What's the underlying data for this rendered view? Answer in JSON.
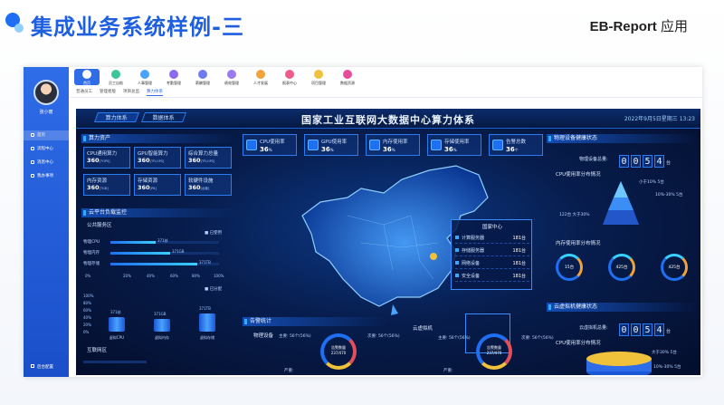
{
  "slide": {
    "title": "集成业务系统样例-三",
    "brand_main": "EB-Report",
    "brand_sub": "应用"
  },
  "sidebar": {
    "user_name": "张小丽",
    "items": [
      {
        "label": "首页",
        "active": true
      },
      {
        "label": "流程中心",
        "active": false
      },
      {
        "label": "消息中心",
        "active": false
      },
      {
        "label": "我办事项",
        "active": false
      }
    ],
    "bottom_label": "后台配置"
  },
  "topnav": {
    "items": [
      {
        "label": "首页",
        "color": "#2f6ce8"
      },
      {
        "label": "员工自助",
        "color": "#3cc59a"
      },
      {
        "label": "人事管理",
        "color": "#4aa3ff"
      },
      {
        "label": "考勤管理",
        "color": "#8b6cf0"
      },
      {
        "label": "薪酬管理",
        "color": "#6d7cf0"
      },
      {
        "label": "绩效管理",
        "color": "#9a7cf0"
      },
      {
        "label": "人才发展",
        "color": "#f0a23b"
      },
      {
        "label": "报表中心",
        "color": "#f05b8a"
      },
      {
        "label": "项目管理",
        "color": "#f0c23b"
      },
      {
        "label": "数据资源",
        "color": "#e84d9b"
      }
    ]
  },
  "tabs": [
    "普通员工",
    "管理者版",
    "项目总监",
    "算力体系"
  ],
  "dashboard": {
    "head_tabs": [
      "算力体系",
      "数据体系"
    ],
    "title": "国家工业互联网大数据中心算力体系",
    "date": "2022年9月5日星期三  13:23",
    "compute": {
      "heading": "算力资产",
      "kpis": [
        {
          "label": "CPU通用算力",
          "value": "360",
          "unit": "[TOPS]"
        },
        {
          "label": "GPU智能算力",
          "value": "360",
          "unit": "[TFLOPS]"
        },
        {
          "label": "综合算力总量",
          "value": "360",
          "unit": "[TFLOPS]"
        },
        {
          "label": "内存资源",
          "value": "360",
          "unit": "[TGB]"
        },
        {
          "label": "存储资源",
          "value": "360",
          "unit": "[PB]"
        },
        {
          "label": "软硬件设施",
          "value": "360",
          "unit": "[台套]"
        }
      ]
    },
    "cloud": {
      "heading": "云平台负载监控",
      "public_heading": "公共服务区",
      "used_legend": "已使用",
      "rows": [
        {
          "label": "物理CPU",
          "value": "371核",
          "pct": 0.42
        },
        {
          "label": "物理内存",
          "value": "371GB",
          "pct": 0.55
        },
        {
          "label": "物理存储",
          "value": "371TB",
          "pct": 0.8
        }
      ],
      "ticks": [
        "0%",
        "20%",
        "40%",
        "60%",
        "80%",
        "100%"
      ],
      "alloc_legend": "已分配",
      "yticks": [
        "100%",
        "80%",
        "60%",
        "40%",
        "20%",
        "0%"
      ],
      "cylinders": [
        {
          "label": "虚拟CPU",
          "value": "371核",
          "pct": 0.4
        },
        {
          "label": "虚拟内存",
          "value": "371GB",
          "pct": 0.35
        },
        {
          "label": "虚拟存储",
          "value": "371TB",
          "pct": 0.5
        }
      ],
      "interconnect_heading": "互联网区"
    },
    "top_kpis": [
      {
        "label": "CPU使用率",
        "value": "36",
        "unit": "%"
      },
      {
        "label": "GPU使用率",
        "value": "36",
        "unit": "%"
      },
      {
        "label": "内存使用率",
        "value": "36",
        "unit": "%"
      },
      {
        "label": "存储使用率",
        "value": "36",
        "unit": "%"
      },
      {
        "label": "告警总数",
        "value": "36",
        "unit": "个"
      }
    ],
    "datacenter": {
      "title": "国家中心",
      "rows": [
        {
          "label": "计算服务器",
          "value": "181台"
        },
        {
          "label": "存储服务器",
          "value": "181台"
        },
        {
          "label": "网络设备",
          "value": "181台"
        },
        {
          "label": "安全设备",
          "value": "181台"
        }
      ]
    },
    "alarm": {
      "heading": "告警统计",
      "physical_label": "物理设备",
      "virtual_label": "云虚拟机",
      "major": "主要: 56个(56%)",
      "minor": "次要: 56个(56%)",
      "ring_text": "告警数量 237/470",
      "severe": "严重:"
    },
    "physical_health": {
      "heading": "物理设备健康状态",
      "total_label": "物理设备总量:",
      "digits": [
        "0",
        "0",
        "5",
        "4"
      ],
      "unit": "台",
      "cpu_dist": "CPU使用率分布情况",
      "pyramid": [
        {
          "label": "小于10%",
          "value": "5台"
        },
        {
          "label": "10%-30%",
          "value": "5台"
        },
        {
          "label": "大于30%",
          "value": "122台"
        }
      ],
      "mem_dist": "内存使用率分布情况",
      "rings": [
        {
          "value": "15台"
        },
        {
          "value": "425台"
        },
        {
          "value": "425台"
        }
      ]
    },
    "vm_health": {
      "heading": "云虚拟机健康状态",
      "total_label": "云虚拟机总量:",
      "digits": [
        "0",
        "0",
        "5",
        "4"
      ],
      "unit": "台",
      "cpu_dist": "CPU使用率分布情况",
      "levels": [
        {
          "label": "大于30%",
          "value": "5台"
        },
        {
          "label": "10%-30%",
          "value": "5台"
        }
      ]
    }
  }
}
